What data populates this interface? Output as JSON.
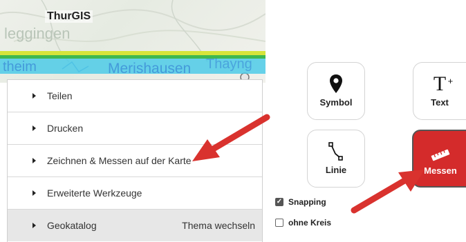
{
  "app": {
    "title": "ThurGIS"
  },
  "map": {
    "places": [
      "leggingen",
      "theim",
      "Merishausen",
      "Thayng"
    ]
  },
  "menu": {
    "items": [
      {
        "label": "Teilen"
      },
      {
        "label": "Drucken"
      },
      {
        "label": "Zeichnen & Messen auf der Karte"
      },
      {
        "label": "Erweiterte Werkzeuge"
      },
      {
        "label": "Geokatalog",
        "right_link": "Thema wechseln"
      }
    ]
  },
  "tools": {
    "symbol": {
      "label": "Symbol",
      "icon": "map-pin-icon"
    },
    "text": {
      "label": "Text",
      "icon": "text-plus-icon"
    },
    "linie": {
      "label": "Linie",
      "icon": "polyline-icon"
    },
    "messen": {
      "label": "Messen",
      "icon": "ruler-icon",
      "active": true
    }
  },
  "options": {
    "snapping": {
      "label": "Snapping",
      "checked": true
    },
    "ohne_kreis": {
      "label": "ohne Kreis",
      "checked": false
    }
  },
  "colors": {
    "accent_red": "#d42b2b",
    "arrow_red": "#d9322e",
    "map_cyan": "#47c9e8"
  }
}
